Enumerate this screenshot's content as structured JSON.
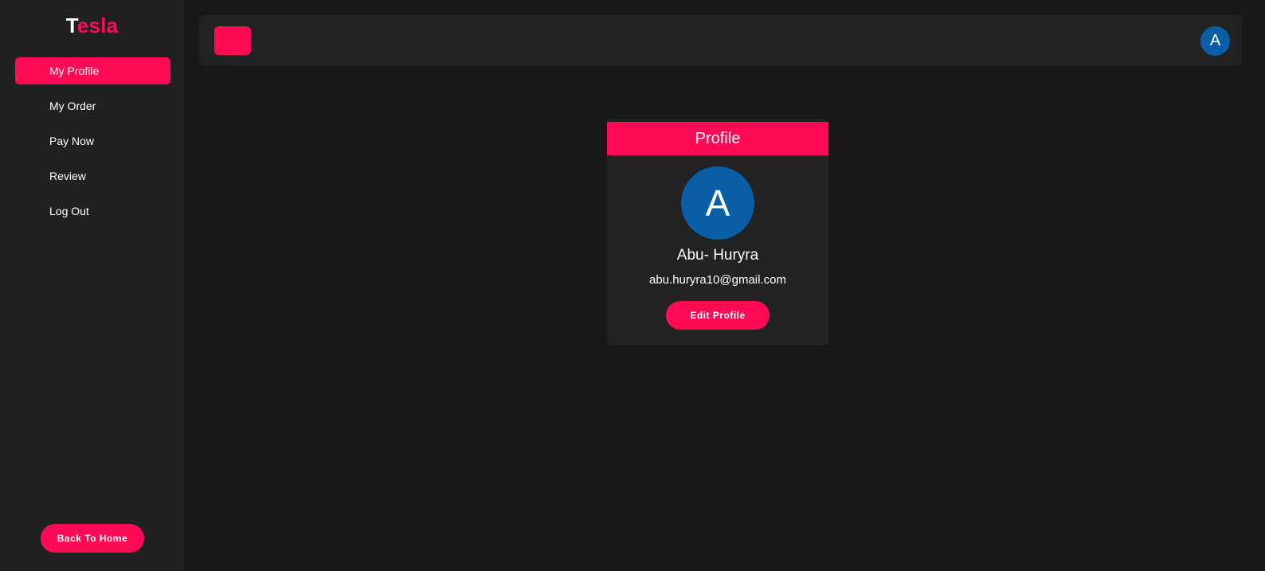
{
  "brand": {
    "first_letter": "T",
    "rest": "esla"
  },
  "sidebar": {
    "items": [
      {
        "label": "My Profile"
      },
      {
        "label": "My Order"
      },
      {
        "label": "Pay Now"
      },
      {
        "label": "Review"
      },
      {
        "label": "Log Out"
      }
    ],
    "back_button": "Back To Home"
  },
  "topbar": {
    "avatar_initial": "A"
  },
  "profile": {
    "header": "Profile",
    "avatar_initial": "A",
    "name": "Abu- Huryra",
    "email": "abu.huryra10@gmail.com",
    "edit_button": "Edit Profile"
  },
  "colors": {
    "accent": "#ff0a54",
    "avatar": "#0a5ea5",
    "background": "#181818",
    "panel": "#222222"
  }
}
